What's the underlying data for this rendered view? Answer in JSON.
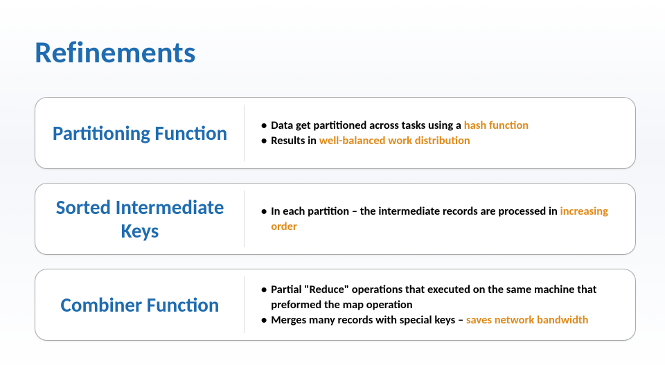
{
  "title": "Refinements",
  "accent_color": "#1f6cb0",
  "highlight_color": "#e08a1a",
  "rows": [
    {
      "label": "Partitioning Function",
      "bullets": [
        {
          "pre": "Data get partitioned across tasks using a ",
          "hl": "hash function",
          "post": ""
        },
        {
          "pre": "Results in ",
          "hl": "well-balanced work distribution",
          "post": ""
        }
      ]
    },
    {
      "label": "Sorted Intermediate Keys",
      "bullets": [
        {
          "pre": "In each partition – the intermediate records are processed in ",
          "hl": "increasing order",
          "post": ""
        }
      ]
    },
    {
      "label": "Combiner Function",
      "bullets": [
        {
          "pre": "Partial \"Reduce\" operations that executed on the same machine that preformed the map operation",
          "hl": "",
          "post": ""
        },
        {
          "pre": "Merges many records with special keys – ",
          "hl": "saves network bandwidth",
          "post": ""
        }
      ]
    }
  ]
}
